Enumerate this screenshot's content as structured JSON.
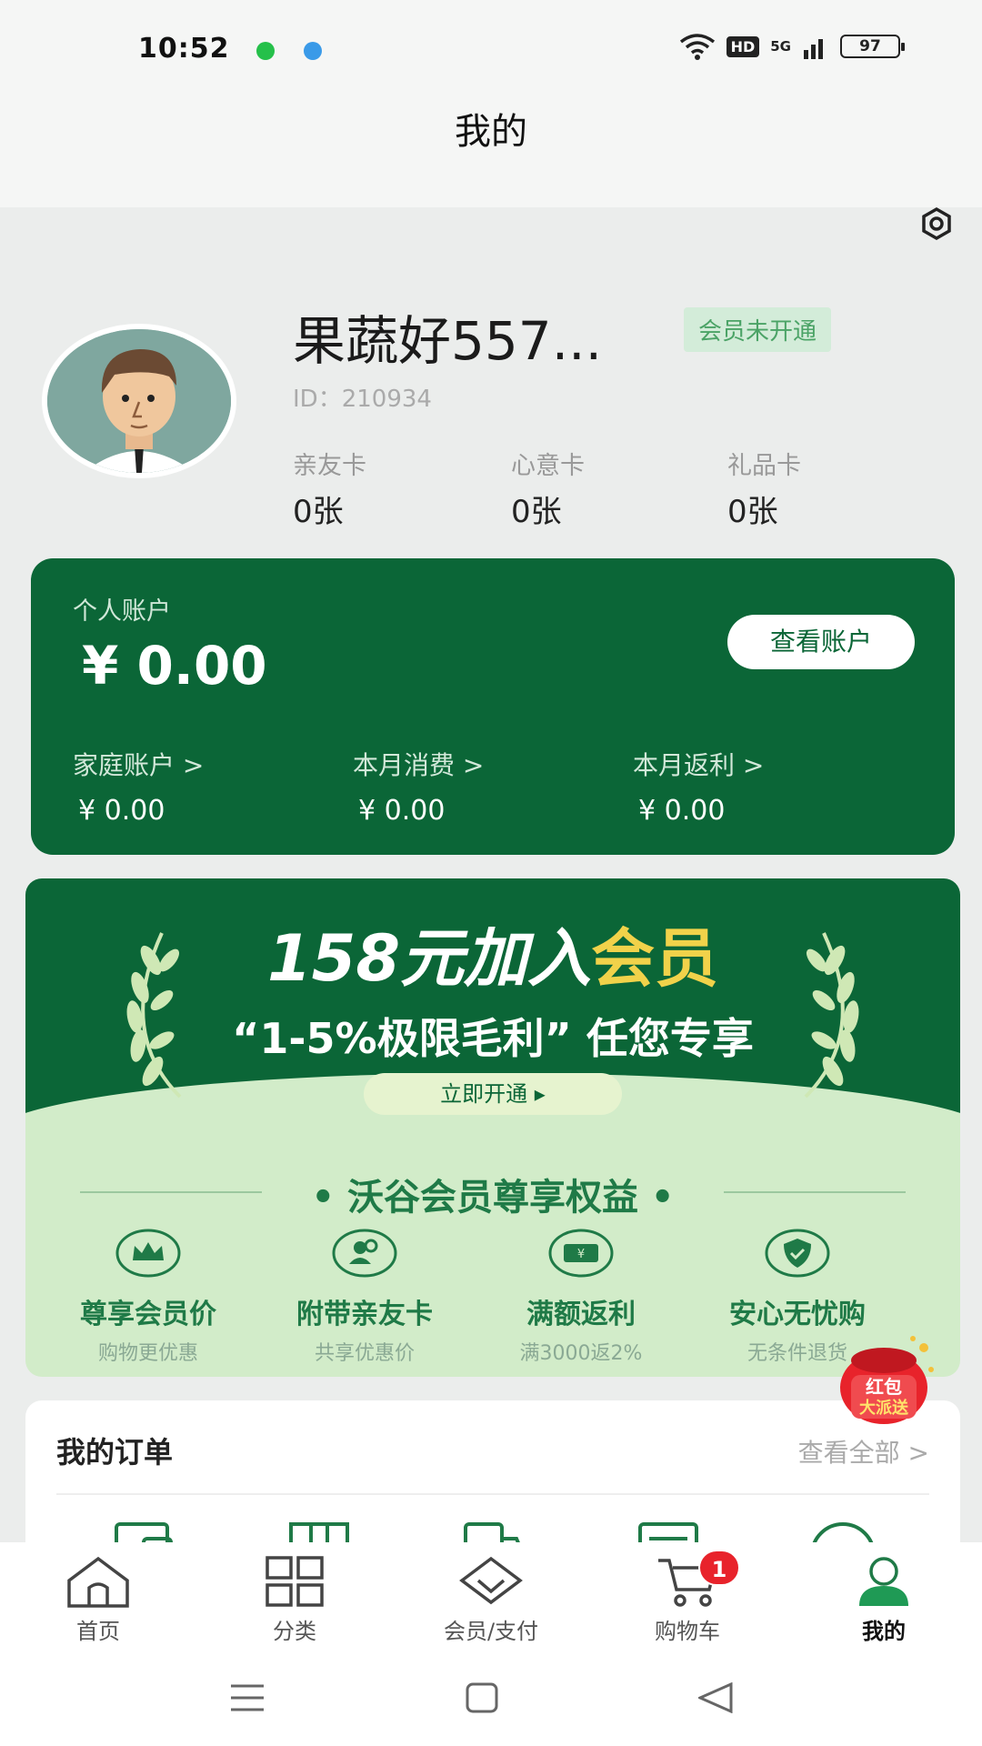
{
  "status_bar": {
    "time": "10:52",
    "battery": "97",
    "network": "5G",
    "hd": "HD"
  },
  "header": {
    "title": "我的"
  },
  "profile": {
    "nickname": "果蔬好557...",
    "member_status": "会员未开通",
    "id_text": "ID：210934",
    "cards": [
      {
        "label": "亲友卡",
        "value": "0张"
      },
      {
        "label": "心意卡",
        "value": "0张"
      },
      {
        "label": "礼品卡",
        "value": "0张"
      }
    ]
  },
  "account": {
    "label": "个人账户",
    "balance": "¥ 0.00",
    "view_button": "查看账户",
    "subs": [
      {
        "label": "家庭账户 >",
        "value": "¥ 0.00"
      },
      {
        "label": "本月消费 >",
        "value": "¥ 0.00"
      },
      {
        "label": "本月返利 >",
        "value": "¥ 0.00"
      }
    ]
  },
  "promo": {
    "headline_prefix": "158元加入",
    "headline_highlight": "会员",
    "subline": "“1-5%极限毛利” 任您专享",
    "button": "立即开通 ▸",
    "benefits_title": "• 沃谷会员尊享权益 •",
    "benefits": [
      {
        "icon": "crown-icon",
        "title": "尊享会员价",
        "sub": "购物更优惠"
      },
      {
        "icon": "friends-icon",
        "title": "附带亲友卡",
        "sub": "共享优惠价"
      },
      {
        "icon": "coupon-icon",
        "title": "满额返利",
        "sub": "满3000返2%"
      },
      {
        "icon": "shield-check-icon",
        "title": "安心无忧购",
        "sub": "无条件退货"
      }
    ]
  },
  "red_packet": {
    "line1": "红包",
    "line2": "大派送"
  },
  "orders": {
    "title": "我的订单",
    "view_all": "查看全部 >",
    "icons": [
      "wallet-icon",
      "package-icon",
      "delivery-truck-icon",
      "document-icon",
      "after-sale-icon"
    ]
  },
  "tabbar": {
    "items": [
      {
        "label": "首页",
        "icon": "home-icon"
      },
      {
        "label": "分类",
        "icon": "grid-icon"
      },
      {
        "label": "会员/支付",
        "icon": "diamond-icon"
      },
      {
        "label": "购物车",
        "icon": "cart-icon",
        "badge": "1"
      },
      {
        "label": "我的",
        "icon": "user-icon",
        "active": true
      }
    ]
  },
  "colors": {
    "brand_green": "#0b6637",
    "light_green": "#d2ecc9",
    "gold": "#f1d24a",
    "badge_red": "#e8232b"
  }
}
